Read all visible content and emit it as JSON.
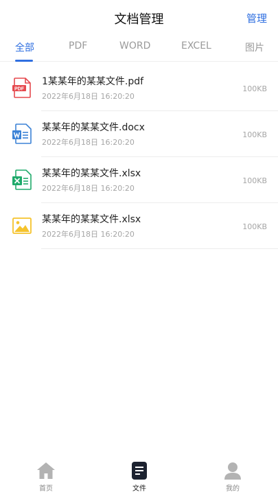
{
  "header": {
    "title": "文档管理",
    "manage_label": "管理"
  },
  "tabs": [
    {
      "label": "全部",
      "active": true
    },
    {
      "label": "PDF",
      "active": false
    },
    {
      "label": "WORD",
      "active": false
    },
    {
      "label": "EXCEL",
      "active": false
    },
    {
      "label": "图片",
      "active": false
    }
  ],
  "files": [
    {
      "name": "1某某年的某某文件.pdf",
      "time": "2022年6月18日  16:20:20",
      "size": "100KB",
      "icon": "pdf-file-icon"
    },
    {
      "name": "某某年的某某文件.docx",
      "time": "2022年6月18日  16:20:20",
      "size": "100KB",
      "icon": "word-file-icon"
    },
    {
      "name": "某某年的某某文件.xlsx",
      "time": "2022年6月18日  16:20:20",
      "size": "100KB",
      "icon": "excel-file-icon"
    },
    {
      "name": "某某年的某某文件.xlsx",
      "time": "2022年6月18日  16:20:20",
      "size": "100KB",
      "icon": "image-file-icon"
    }
  ],
  "icon_labels": {
    "pdf": "PDF"
  },
  "bottom_nav": [
    {
      "label": "首页",
      "icon": "home-icon",
      "active": false
    },
    {
      "label": "文件",
      "icon": "document-icon",
      "active": true
    },
    {
      "label": "我的",
      "icon": "user-icon",
      "active": false
    }
  ],
  "colors": {
    "accent": "#2f6fe0",
    "pdf": "#e5484d",
    "word": "#3b82d6",
    "excel": "#1faa6b",
    "image": "#f5c32c"
  }
}
